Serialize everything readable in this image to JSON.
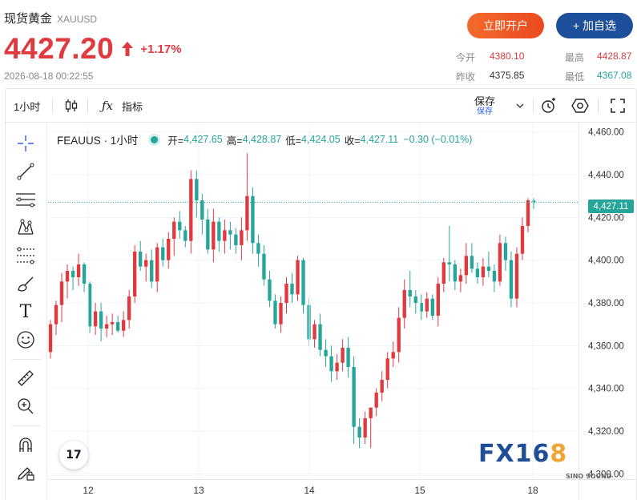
{
  "header": {
    "title": "现货黄金",
    "symbol": "XAUUSD",
    "price": "4427.20",
    "change_pct": "+1.17%",
    "datetime": "2026-08-18 00:22:55",
    "btn_open": "立即开户",
    "btn_watch": "+ 加自选",
    "stats": {
      "open_label": "今开",
      "open_value": "4380.10",
      "high_label": "最高",
      "high_value": "4428.87",
      "prev_label": "昨收",
      "prev_value": "4375.85",
      "low_label": "最低",
      "low_value": "4367.08"
    },
    "colors": {
      "up": "#e0393e",
      "down": "#26a69a",
      "accent_orange": "#ea4a20",
      "accent_blue": "#1e4f9b"
    }
  },
  "toolbar": {
    "interval": "1小时",
    "candle_icon": "candlestick-icon",
    "fx_icon": "function-icon",
    "indicators": "指标",
    "save_top": "保存",
    "save_bottom": "保存",
    "icons": [
      "chevron-down-icon",
      "alert-clock-icon",
      "settings-hexagon-icon",
      "fullscreen-icon"
    ]
  },
  "sidebar": {
    "icons": [
      "crosshair-icon",
      "trend-line-icon",
      "fib-lines-icon",
      "pattern-icon",
      "projection-icon",
      "brush-icon",
      "text-icon",
      "emoji-icon",
      "ruler-icon",
      "zoom-in-icon",
      "magnet-icon",
      "lock-pencil-icon"
    ]
  },
  "legend": {
    "name": "FEAUUS · 1小时",
    "o_label": "开=",
    "o_value": "4,427.65",
    "h_label": "高=",
    "h_value": "4,428.87",
    "l_label": "低=",
    "l_value": "4,424.05",
    "c_label": "收=",
    "c_value": "4,427.11",
    "change": "−0.30 (−0.01%)"
  },
  "last_price_tag": "4,427.11",
  "watermark": {
    "part1": "FX16",
    "part2": "8",
    "sub": "SINO SOUND"
  },
  "tv_logo": "17",
  "chart_data": {
    "type": "candlestick",
    "title": "FEAUUS · 1小时",
    "y_ticks": [
      "4,460.00",
      "4,440.00",
      "4,420.00",
      "4,400.00",
      "4,380.00",
      "4,360.00",
      "4,340.00",
      "4,320.00",
      "4,300.00"
    ],
    "ylim": [
      4297.5,
      4464
    ],
    "x_labels": [
      "12",
      "13",
      "14",
      "15",
      "18"
    ],
    "last_price": 4427.11,
    "candles": [
      [
        4357,
        4372,
        4354,
        4370
      ],
      [
        4370,
        4381,
        4365,
        4379
      ],
      [
        4379,
        4394,
        4371,
        4390
      ],
      [
        4390,
        4398,
        4382,
        4395
      ],
      [
        4395,
        4397,
        4386,
        4392
      ],
      [
        4392,
        4403,
        4388,
        4398
      ],
      [
        4398,
        4399,
        4385,
        4389
      ],
      [
        4389,
        4390,
        4366,
        4369
      ],
      [
        4369,
        4380,
        4365,
        4376
      ],
      [
        4376,
        4380,
        4362,
        4368
      ],
      [
        4368,
        4374,
        4364,
        4370
      ],
      [
        4370,
        4375,
        4365,
        4371
      ],
      [
        4371,
        4374,
        4366,
        4367
      ],
      [
        4367,
        4376,
        4364,
        4372
      ],
      [
        4372,
        4386,
        4368,
        4383
      ],
      [
        4383,
        4407,
        4380,
        4404
      ],
      [
        4404,
        4409,
        4395,
        4397
      ],
      [
        4397,
        4403,
        4390,
        4400
      ],
      [
        4400,
        4405,
        4387,
        4390
      ],
      [
        4390,
        4408,
        4385,
        4406
      ],
      [
        4406,
        4410,
        4397,
        4400
      ],
      [
        4400,
        4413,
        4396,
        4410
      ],
      [
        4410,
        4420,
        4402,
        4418
      ],
      [
        4418,
        4423,
        4410,
        4414
      ],
      [
        4414,
        4416,
        4406,
        4409
      ],
      [
        4409,
        4442,
        4403,
        4438
      ],
      [
        4438,
        4442,
        4420,
        4428
      ],
      [
        4428,
        4431,
        4412,
        4419
      ],
      [
        4419,
        4424,
        4403,
        4405
      ],
      [
        4405,
        4424,
        4399,
        4418
      ],
      [
        4418,
        4420,
        4404,
        4409
      ],
      [
        4409,
        4419,
        4403,
        4414
      ],
      [
        4414,
        4418,
        4405,
        4412
      ],
      [
        4412,
        4415,
        4403,
        4407
      ],
      [
        4407,
        4420,
        4400,
        4414
      ],
      [
        4414,
        4450,
        4409,
        4430
      ],
      [
        4430,
        4434,
        4403,
        4408
      ],
      [
        4408,
        4412,
        4397,
        4403
      ],
      [
        4403,
        4407,
        4388,
        4391
      ],
      [
        4391,
        4395,
        4378,
        4381
      ],
      [
        4381,
        4384,
        4368,
        4370
      ],
      [
        4370,
        4383,
        4366,
        4380
      ],
      [
        4380,
        4392,
        4375,
        4389
      ],
      [
        4389,
        4394,
        4380,
        4384
      ],
      [
        4384,
        4402,
        4381,
        4400
      ],
      [
        4400,
        4401,
        4375,
        4379
      ],
      [
        4379,
        4382,
        4360,
        4363
      ],
      [
        4363,
        4372,
        4359,
        4370
      ],
      [
        4370,
        4375,
        4355,
        4358
      ],
      [
        4358,
        4363,
        4350,
        4355
      ],
      [
        4355,
        4360,
        4343,
        4348
      ],
      [
        4348,
        4356,
        4344,
        4352
      ],
      [
        4352,
        4363,
        4348,
        4359
      ],
      [
        4359,
        4364,
        4345,
        4350
      ],
      [
        4350,
        4355,
        4314,
        4322
      ],
      [
        4322,
        4326,
        4312,
        4317
      ],
      [
        4317,
        4329,
        4314,
        4326
      ],
      [
        4326,
        4331,
        4312,
        4331
      ],
      [
        4331,
        4340,
        4327,
        4338
      ],
      [
        4338,
        4348,
        4334,
        4344
      ],
      [
        4344,
        4357,
        4340,
        4354
      ],
      [
        4354,
        4362,
        4350,
        4357
      ],
      [
        4357,
        4378,
        4352,
        4373
      ],
      [
        4373,
        4391,
        4368,
        4386
      ],
      [
        4386,
        4395,
        4378,
        4383
      ],
      [
        4383,
        4386,
        4375,
        4380
      ],
      [
        4380,
        4384,
        4372,
        4376
      ],
      [
        4376,
        4385,
        4373,
        4382
      ],
      [
        4382,
        4384,
        4372,
        4374
      ],
      [
        4374,
        4392,
        4369,
        4389
      ],
      [
        4389,
        4401,
        4385,
        4399
      ],
      [
        4399,
        4416,
        4390,
        4398
      ],
      [
        4398,
        4400,
        4386,
        4390
      ],
      [
        4390,
        4396,
        4385,
        4393
      ],
      [
        4393,
        4408,
        4389,
        4402
      ],
      [
        4402,
        4408,
        4394,
        4396
      ],
      [
        4396,
        4399,
        4389,
        4392
      ],
      [
        4392,
        4401,
        4388,
        4397
      ],
      [
        4397,
        4404,
        4392,
        4395
      ],
      [
        4395,
        4398,
        4385,
        4390
      ],
      [
        4390,
        4412,
        4388,
        4408
      ],
      [
        4408,
        4411,
        4395,
        4400
      ],
      [
        4400,
        4404,
        4378,
        4382
      ],
      [
        4382,
        4406,
        4378,
        4403
      ],
      [
        4403,
        4420,
        4400,
        4416
      ],
      [
        4416,
        4429,
        4413,
        4428
      ],
      [
        4428,
        4429,
        4424,
        4427
      ]
    ]
  }
}
